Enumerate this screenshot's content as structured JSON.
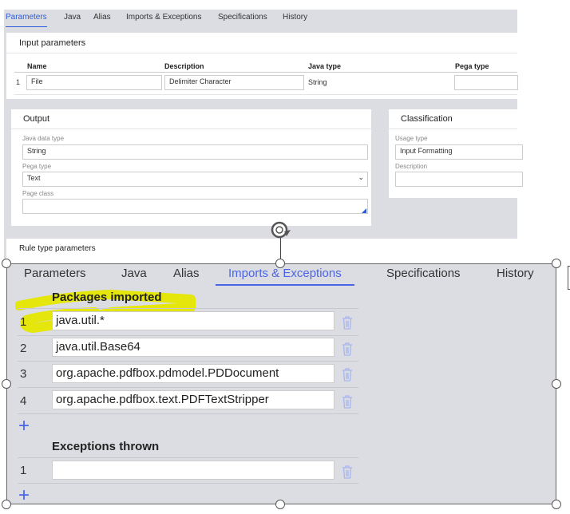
{
  "top": {
    "tabs": [
      "Parameters",
      "Java",
      "Alias",
      "Imports & Exceptions",
      "Specifications",
      "History"
    ],
    "active_tab": "Parameters",
    "input_parameters": {
      "title": "Input parameters",
      "columns": [
        "Name",
        "Description",
        "Java type",
        "Pega type"
      ],
      "rows": [
        {
          "num": "1",
          "name": "File",
          "description": "Delimiter Character",
          "java_type": "String",
          "pega_type": ""
        }
      ]
    },
    "output": {
      "title": "Output",
      "java_data_type_label": "Java data type",
      "java_data_type": "String",
      "pega_type_label": "Pega type",
      "pega_type": "Text",
      "page_class_label": "Page class",
      "page_class": ""
    },
    "classification": {
      "title": "Classification",
      "usage_type_label": "Usage type",
      "usage_type": "Input Formatting",
      "description_label": "Description",
      "description": ""
    },
    "rule_type_parameters": {
      "title": "Rule type parameters"
    }
  },
  "bottom": {
    "tabs": [
      "Parameters",
      "Java",
      "Alias",
      "Imports & Exceptions",
      "Specifications",
      "History"
    ],
    "active_tab": "Imports & Exceptions",
    "packages_title": "Packages imported",
    "packages": [
      {
        "num": "1",
        "value": "java.util.*"
      },
      {
        "num": "2",
        "value": "java.util.Base64"
      },
      {
        "num": "3",
        "value": "org.apache.pdfbox.pdmodel.PDDocument"
      },
      {
        "num": "4",
        "value": "org.apache.pdfbox.text.PDFTextStripper"
      }
    ],
    "exceptions_title": "Exceptions thrown",
    "exceptions": [
      {
        "num": "1",
        "value": ""
      }
    ],
    "highlight_color": "#e4e600",
    "accent_color": "#4a64e8"
  }
}
